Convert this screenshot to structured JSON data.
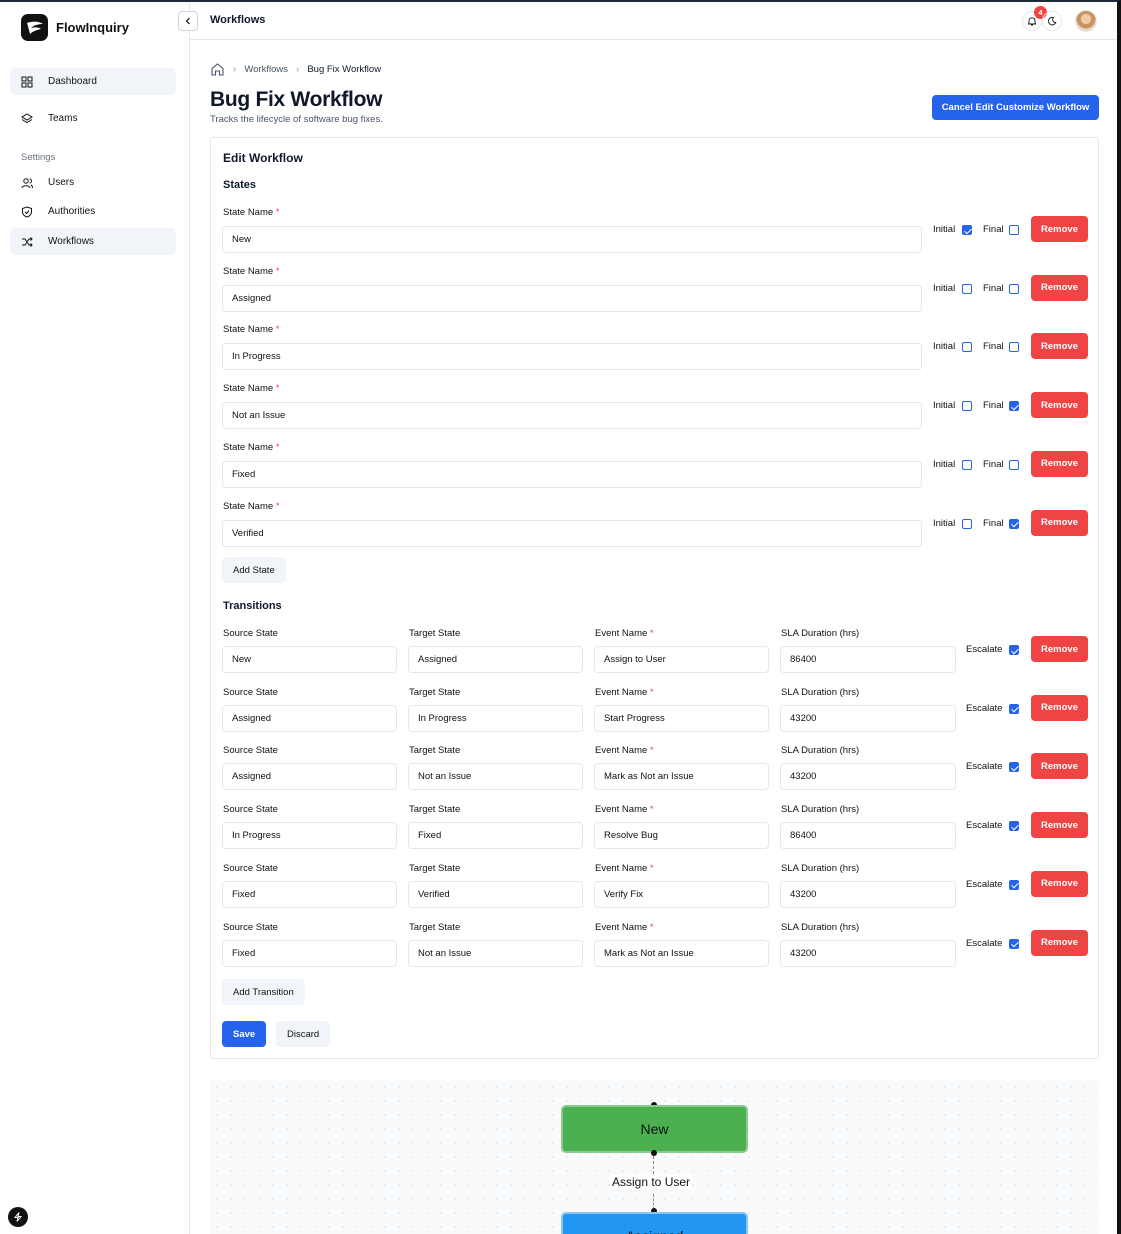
{
  "app": {
    "name": "FlowInquiry"
  },
  "sidebar": {
    "items": [
      {
        "label": "Dashboard",
        "icon": "dashboard-icon"
      },
      {
        "label": "Teams",
        "icon": "layers-icon"
      }
    ],
    "settings_label": "Settings",
    "settings_items": [
      {
        "label": "Users",
        "icon": "users-icon"
      },
      {
        "label": "Authorities",
        "icon": "shield-icon"
      },
      {
        "label": "Workflows",
        "icon": "shuffle-icon"
      }
    ]
  },
  "topbar": {
    "title": "Workflows",
    "notification_count": "4"
  },
  "breadcrumb": {
    "items": [
      "Workflows",
      "Bug Fix Workflow"
    ]
  },
  "page": {
    "title": "Bug Fix Workflow",
    "subtitle": "Tracks the lifecycle of software bug fixes.",
    "cancel_label": "Cancel Edit Customize Workflow"
  },
  "form": {
    "title": "Edit Workflow",
    "states_heading": "States",
    "state_name_label": "State Name",
    "initial_label": "Initial",
    "final_label": "Final",
    "remove_label": "Remove",
    "states": [
      {
        "name": "New",
        "initial": true,
        "final": false
      },
      {
        "name": "Assigned",
        "initial": false,
        "final": false
      },
      {
        "name": "In Progress",
        "initial": false,
        "final": false
      },
      {
        "name": "Not an Issue",
        "initial": false,
        "final": true
      },
      {
        "name": "Fixed",
        "initial": false,
        "final": false
      },
      {
        "name": "Verified",
        "initial": false,
        "final": true
      }
    ],
    "add_state_label": "Add State",
    "transitions_heading": "Transitions",
    "source_label": "Source State",
    "target_label": "Target State",
    "event_label": "Event Name",
    "sla_label": "SLA Duration (hrs)",
    "escalate_label": "Escalate",
    "transitions": [
      {
        "source": "New",
        "target": "Assigned",
        "event": "Assign to User",
        "sla": "86400",
        "escalate": true
      },
      {
        "source": "Assigned",
        "target": "In Progress",
        "event": "Start Progress",
        "sla": "43200",
        "escalate": true
      },
      {
        "source": "Assigned",
        "target": "Not an Issue",
        "event": "Mark as Not an Issue",
        "sla": "43200",
        "escalate": true
      },
      {
        "source": "In Progress",
        "target": "Fixed",
        "event": "Resolve Bug",
        "sla": "86400",
        "escalate": true
      },
      {
        "source": "Fixed",
        "target": "Verified",
        "event": "Verify Fix",
        "sla": "43200",
        "escalate": true
      },
      {
        "source": "Fixed",
        "target": "Not an Issue",
        "event": "Mark as Not an Issue",
        "sla": "43200",
        "escalate": true
      }
    ],
    "add_transition_label": "Add Transition",
    "save_label": "Save",
    "discard_label": "Discard"
  },
  "diagram": {
    "nodes": [
      {
        "label": "New",
        "color": "#4caf50"
      },
      {
        "label": "Assigned",
        "color": "#2196f3"
      }
    ],
    "edge_label": "Assign to User"
  }
}
